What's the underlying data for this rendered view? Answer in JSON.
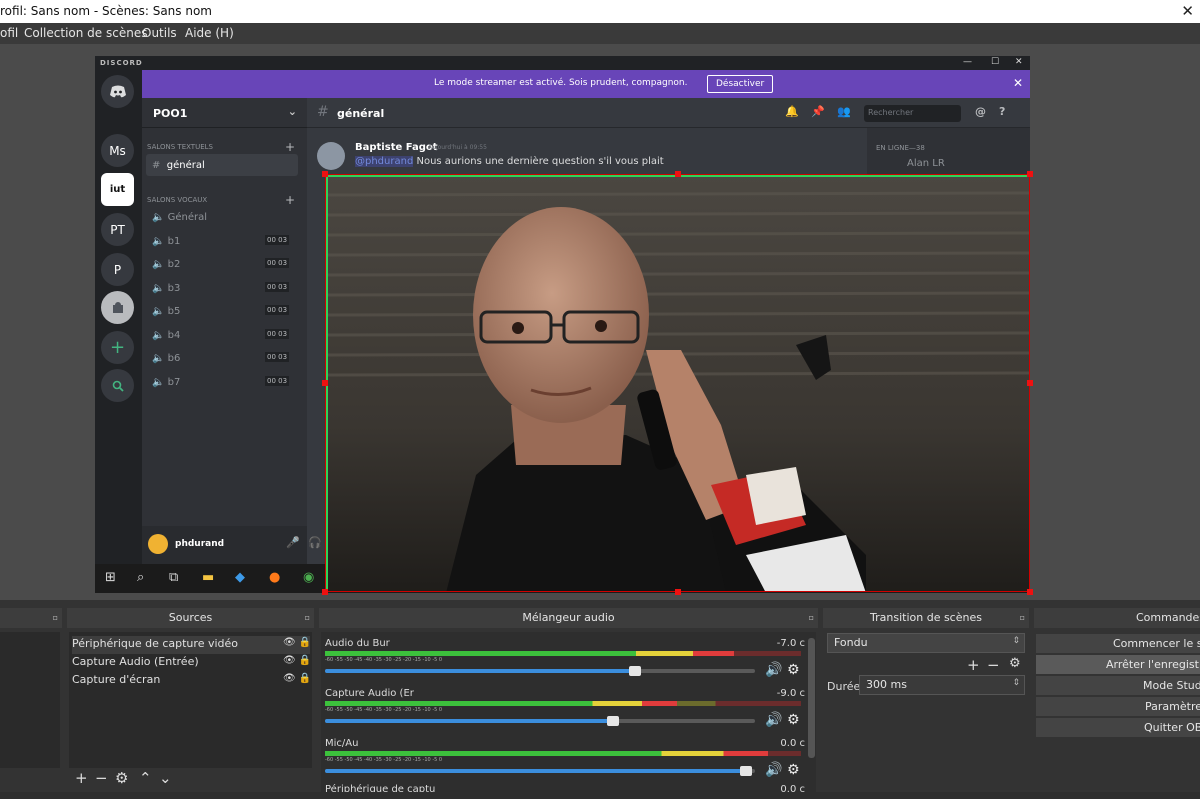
{
  "window": {
    "title": "rofil: Sans nom - Scènes: Sans nom",
    "close_glyph": "✕"
  },
  "menu": {
    "items": [
      "ofil",
      "Collection de scènes",
      "Outils",
      "Aide (H)"
    ]
  },
  "discord": {
    "brand": "DISCORD",
    "window_controls": [
      "—",
      "☐",
      "✕"
    ],
    "banner": {
      "text": "Le mode streamer est activé. Sois prudent, compagnon.",
      "button": "Désactiver",
      "close": "✕"
    },
    "guilds": [
      "Ms",
      "iut",
      "PT",
      "P"
    ],
    "server": {
      "name": "POO1",
      "chevron": "⌄"
    },
    "categories": {
      "text": "SALONS TEXTUELS",
      "voice": "SALONS VOCAUX"
    },
    "text_channels": [
      {
        "name": "général"
      }
    ],
    "voice_channels": [
      {
        "name": "Général"
      },
      {
        "name": "b1",
        "count": "00 03"
      },
      {
        "name": "b2",
        "count": "00 03"
      },
      {
        "name": "b3",
        "count": "00 03"
      },
      {
        "name": "b5",
        "count": "00 03"
      },
      {
        "name": "b4",
        "count": "00 03"
      },
      {
        "name": "b6",
        "count": "00 03"
      },
      {
        "name": "b7",
        "count": "00 03"
      }
    ],
    "user": {
      "name": "phdurand"
    },
    "chat": {
      "channel": "général",
      "search_placeholder": "Rechercher",
      "message": {
        "author": "Baptiste Fagot",
        "timestamp": "Aujourd'hui à 09:55",
        "mention": "@phdurand",
        "text": " Nous aurions une dernière question s'il vous plait"
      }
    },
    "members": {
      "category": "EN LIGNE—38",
      "first": "Alan LR"
    }
  },
  "docks": {
    "scenes": {
      "title": ""
    },
    "sources": {
      "title": "Sources",
      "items": [
        "Périphérique de capture vidéo",
        "Capture Audio (Entrée)",
        "Capture d'écran"
      ]
    },
    "mixer": {
      "title": "Mélangeur audio",
      "tick_labels": "-60   -55   -50   -45   -40   -35   -30   -25   -20   -15   -10   -5    0",
      "channels": [
        {
          "name": "Audio du Bur",
          "db": "-7.0 c",
          "level": 0.86,
          "volume": 0.72
        },
        {
          "name": "Capture Audio (Er",
          "db": "-9.0 c",
          "level": 0.74,
          "volume": 0.67
        },
        {
          "name": "Mic/Au",
          "db": "0.0 c",
          "level": 0.93,
          "volume": 0.98
        }
      ],
      "partial": "Périphérique de captu",
      "partial_db": "0.0 c"
    },
    "transition": {
      "title": "Transition de scènes",
      "type": "Fondu",
      "duration_label": "Durée",
      "duration": "300 ms"
    },
    "commands": {
      "title": "Commandes",
      "buttons": [
        "Commencer le stre",
        "Arrêter l'enregistrem",
        "Mode Studio",
        "Paramètres",
        "Quitter OBS"
      ]
    },
    "icons": {
      "add": "+",
      "remove": "−",
      "gear": "⚙",
      "up": "⌃",
      "down": "⌄",
      "eye": "👁",
      "lock": "🔒",
      "speaker": "🔊"
    }
  }
}
